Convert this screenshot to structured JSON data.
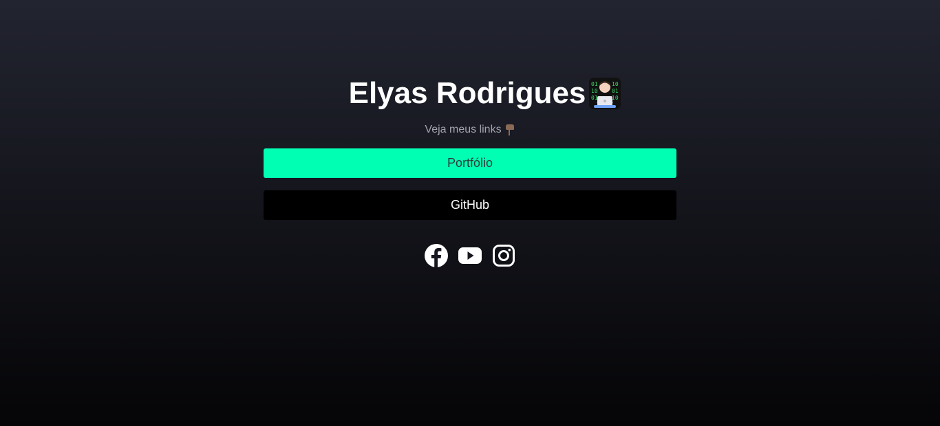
{
  "profile": {
    "name": "Elyas Rodrigues",
    "subtitle": "Veja meus links"
  },
  "links": [
    {
      "label": "Portfólio",
      "color": "#00ffb3",
      "text_color": "#2f3a3a"
    },
    {
      "label": "GitHub",
      "color": "#000000",
      "text_color": "#ffffff"
    }
  ],
  "social": [
    {
      "icon": "facebook-icon"
    },
    {
      "icon": "youtube-icon"
    },
    {
      "icon": "instagram-icon"
    }
  ]
}
